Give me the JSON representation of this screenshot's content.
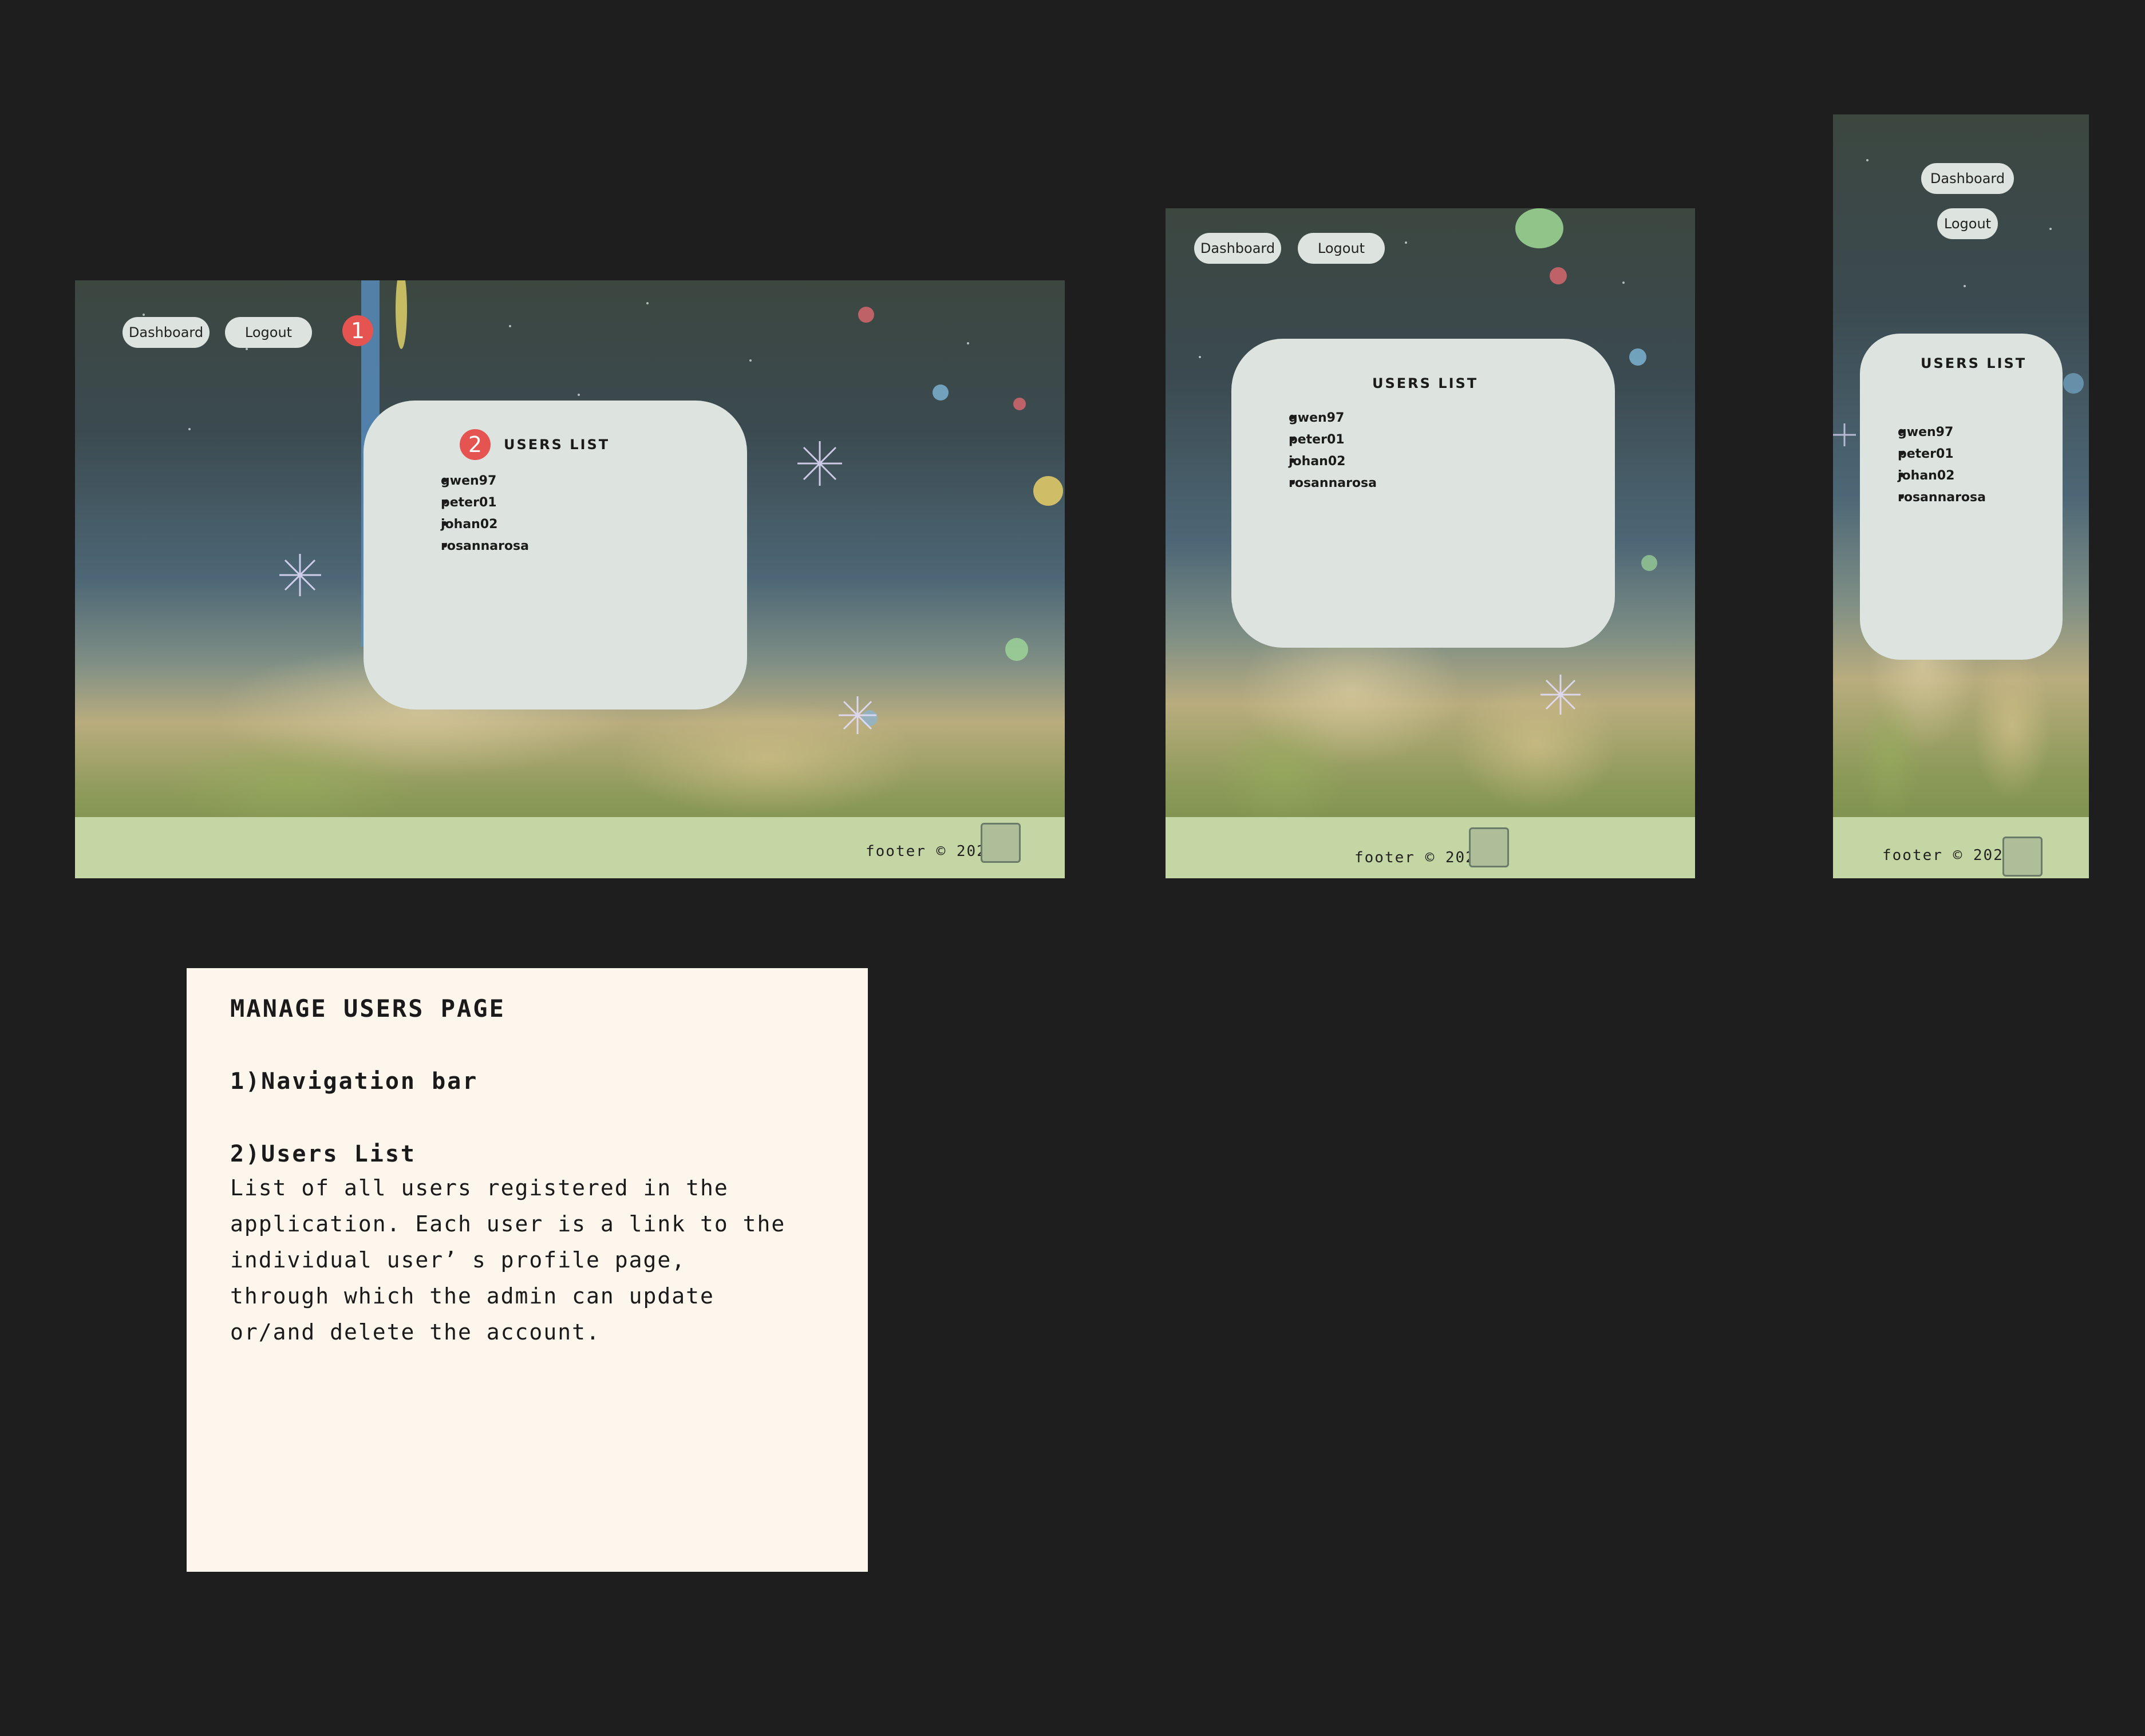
{
  "nav": {
    "dashboard_label": "Dashboard",
    "logout_label": "Logout"
  },
  "users_list": {
    "title": "USERS LIST",
    "users": [
      "gwen97",
      "peter01",
      "johan02",
      "rosannarosa"
    ]
  },
  "footer": {
    "text": "footer © 2024"
  },
  "badges": {
    "one": "1",
    "two": "2"
  },
  "note": {
    "title": "MANAGE USERS PAGE",
    "item1": "1)Navigation bar",
    "item2": "2)Users List",
    "line1": "List of all users registered in the",
    "line2": "application. Each user is a link to the",
    "line3": "individual user’ s profile page,",
    "line4": "through which the admin can update",
    "line5": "or/and delete the account."
  },
  "colors": {
    "background": "#1e1e1e",
    "footer": "#c3d6a4",
    "card": "#dde4e0",
    "badge": "#e55451",
    "note": "#fdf6ec"
  }
}
